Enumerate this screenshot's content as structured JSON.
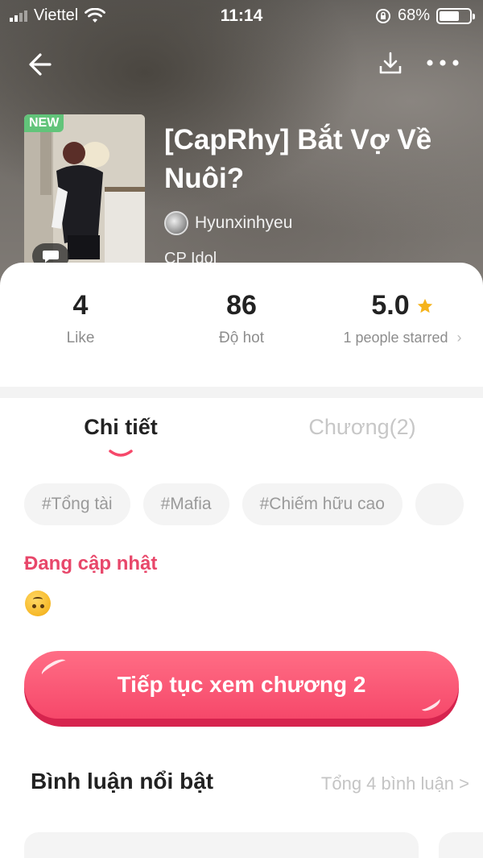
{
  "status_bar": {
    "carrier": "Viettel",
    "time": "11:14",
    "battery": "68%",
    "battery_level": 0.68
  },
  "nav": {
    "back_icon": "arrow-left-icon",
    "download_icon": "download-icon",
    "more_icon": "more-dots-icon"
  },
  "story": {
    "badge": "NEW",
    "title": "[CapRhy] Bắt Vợ Về Nuôi?",
    "author": "Hyunxinhyeu",
    "category": "CP Idol"
  },
  "stats": {
    "likes": "4",
    "likes_label": "Like",
    "hot": "86",
    "hot_label": "Độ hot",
    "rating": "5.0",
    "rating_label": "1 people starred",
    "rating_chevron": "›",
    "star_color": "#f5b31c"
  },
  "tabs": [
    {
      "label": "Chi tiết",
      "active": true
    },
    {
      "label": "Chương(2)",
      "active": false
    }
  ],
  "tags": [
    "#Tổng tài",
    "#Mafia",
    "#Chiếm hữu cao"
  ],
  "update_status": "Đang cập nhật",
  "continue_button": {
    "label": "Tiếp tục xem chương 2",
    "color": "#f6486a"
  },
  "comments": {
    "title": "Bình luận nổi bật",
    "total": "Tổng 4 bình luận >"
  }
}
